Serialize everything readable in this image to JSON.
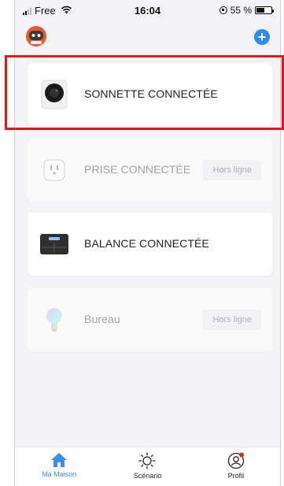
{
  "status_bar": {
    "carrier": "Free",
    "time": "16:04",
    "battery_text": "55 %",
    "battery_level": 0.55
  },
  "header": {
    "add_button": "+"
  },
  "devices": [
    {
      "name": "SONNETTE CONNECTÉE",
      "status": "",
      "icon": "doorbell-icon"
    },
    {
      "name": "PRISE CONNECTÉE",
      "status": "Hors ligne",
      "icon": "plug-icon"
    },
    {
      "name": "BALANCE CONNECTÉE",
      "status": "",
      "icon": "scale-icon"
    },
    {
      "name": "Bureau",
      "status": "Hors ligne",
      "icon": "bulb-icon"
    }
  ],
  "tabbar": {
    "tabs": [
      {
        "label": "Ma Maison",
        "icon": "home-icon"
      },
      {
        "label": "Scénario",
        "icon": "sun-icon"
      },
      {
        "label": "Profil",
        "icon": "profile-icon"
      }
    ]
  },
  "colors": {
    "accent": "#3d8cf2",
    "highlight": "#e8141c",
    "robot": "#f0552b"
  }
}
